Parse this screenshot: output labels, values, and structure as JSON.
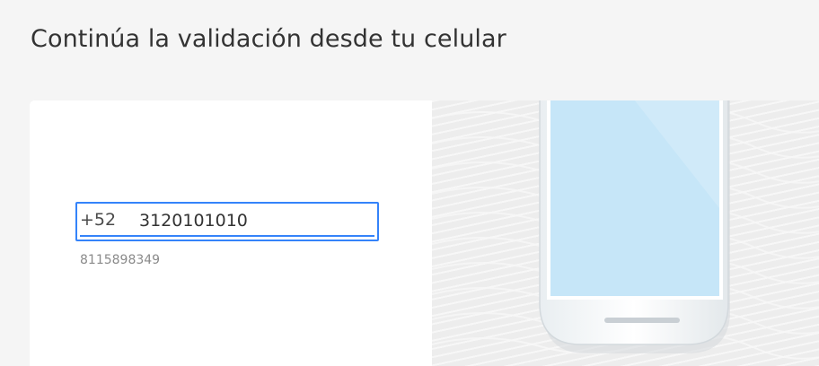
{
  "page": {
    "title": "Continúa la validación desde tu celular"
  },
  "phone_form": {
    "country_code": "+52",
    "phone_value": "3120101010",
    "hint": "8115898349"
  },
  "colors": {
    "accent": "#3483fa",
    "page_background": "#f5f5f5",
    "card_background": "#ffffff",
    "screen": "#c6e6f8",
    "illustration_background": "#ededed"
  },
  "icons": {
    "phone_illustration": "smartphone-illustration"
  }
}
